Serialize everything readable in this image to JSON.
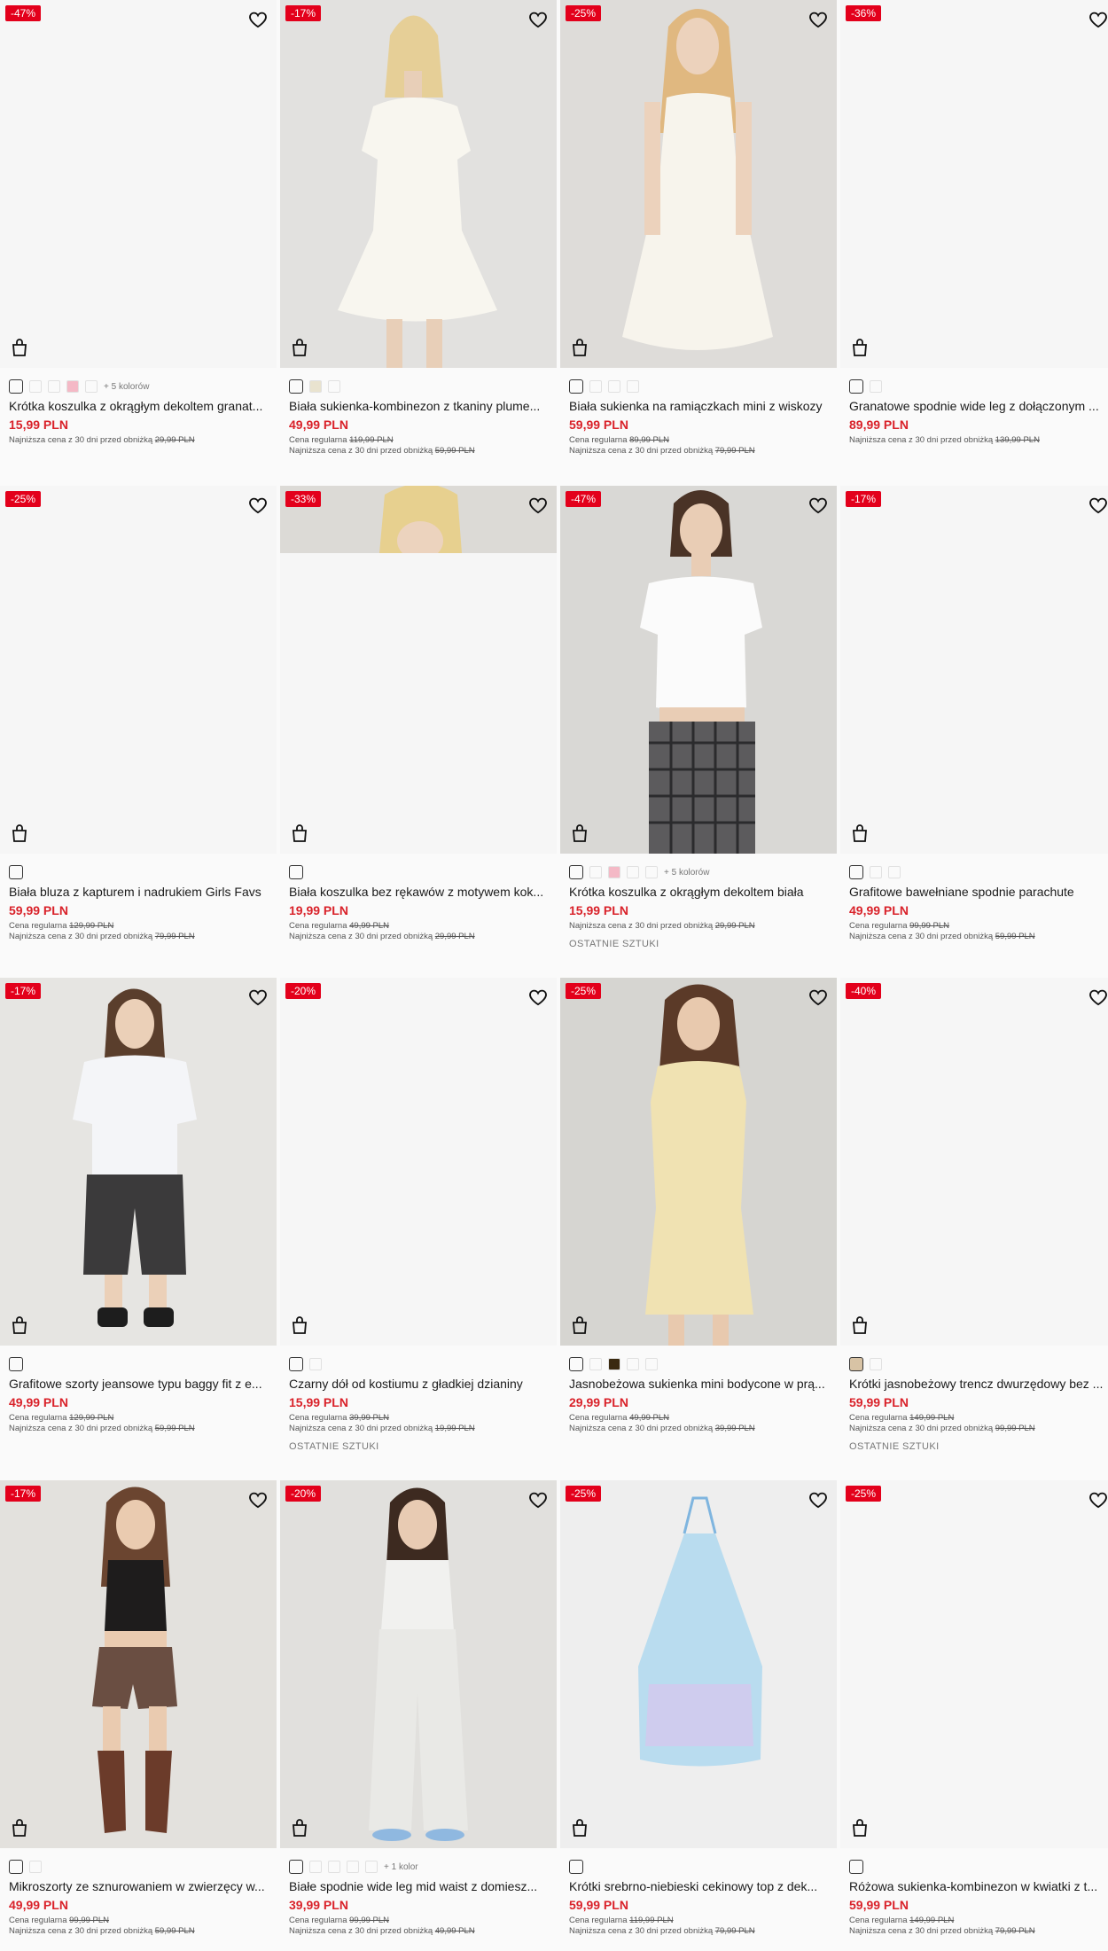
{
  "products": [
    {
      "discount": "-47%",
      "name": "Krótka koszulka z okrągłym dekoltem granat...",
      "price": "15,99 PLN",
      "regular_label": "",
      "regular_price": "",
      "lowest_label": "Najniższa cena z 30 dni przed obniżką",
      "lowest_price": "29,99 PLN",
      "more_colors": "+ 5 kolorów",
      "last_items": ""
    },
    {
      "discount": "-17%",
      "name": "Biała sukienka-kombinezon z tkaniny plume...",
      "price": "49,99 PLN",
      "regular_label": "Cena regularna",
      "regular_price": "119,99 PLN",
      "lowest_label": "Najniższa cena z 30 dni przed obniżką",
      "lowest_price": "59,99 PLN",
      "more_colors": "",
      "last_items": ""
    },
    {
      "discount": "-25%",
      "name": "Biała sukienka na ramiączkach mini z wiskozy",
      "price": "59,99 PLN",
      "regular_label": "Cena regularna",
      "regular_price": "89,99 PLN",
      "lowest_label": "Najniższa cena z 30 dni przed obniżką",
      "lowest_price": "79,99 PLN",
      "more_colors": "",
      "last_items": ""
    },
    {
      "discount": "-36%",
      "name": "Granatowe spodnie wide leg z dołączonym ...",
      "price": "89,99 PLN",
      "regular_label": "",
      "regular_price": "",
      "lowest_label": "Najniższa cena z 30 dni przed obniżką",
      "lowest_price": "139,99 PLN",
      "more_colors": "",
      "last_items": ""
    },
    {
      "discount": "-25%",
      "name": "Biała bluza z kapturem i nadrukiem Girls Favs",
      "price": "59,99 PLN",
      "regular_label": "Cena regularna",
      "regular_price": "129,99 PLN",
      "lowest_label": "Najniższa cena z 30 dni przed obniżką",
      "lowest_price": "79,99 PLN",
      "more_colors": "",
      "last_items": ""
    },
    {
      "discount": "-33%",
      "name": "Biała koszulka bez rękawów z motywem kok...",
      "price": "19,99 PLN",
      "regular_label": "Cena regularna",
      "regular_price": "49,99 PLN",
      "lowest_label": "Najniższa cena z 30 dni przed obniżką",
      "lowest_price": "29,99 PLN",
      "more_colors": "",
      "last_items": ""
    },
    {
      "discount": "-47%",
      "name": "Krótka koszulka z okrągłym dekoltem biała",
      "price": "15,99 PLN",
      "regular_label": "",
      "regular_price": "",
      "lowest_label": "Najniższa cena z 30 dni przed obniżką",
      "lowest_price": "29,99 PLN",
      "more_colors": "+ 5 kolorów",
      "last_items": "OSTATNIE SZTUKI"
    },
    {
      "discount": "-17%",
      "name": "Grafitowe bawełniane spodnie parachute",
      "price": "49,99 PLN",
      "regular_label": "Cena regularna",
      "regular_price": "99,99 PLN",
      "lowest_label": "Najniższa cena z 30 dni przed obniżką",
      "lowest_price": "59,99 PLN",
      "more_colors": "",
      "last_items": ""
    },
    {
      "discount": "-17%",
      "name": "Grafitowe szorty jeansowe typu baggy fit z e...",
      "price": "49,99 PLN",
      "regular_label": "Cena regularna",
      "regular_price": "129,99 PLN",
      "lowest_label": "Najniższa cena z 30 dni przed obniżką",
      "lowest_price": "59,99 PLN",
      "more_colors": "",
      "last_items": ""
    },
    {
      "discount": "-20%",
      "name": "Czarny dół od kostiumu z gładkiej dzianiny",
      "price": "15,99 PLN",
      "regular_label": "Cena regularna",
      "regular_price": "39,99 PLN",
      "lowest_label": "Najniższa cena z 30 dni przed obniżką",
      "lowest_price": "19,99 PLN",
      "more_colors": "",
      "last_items": "OSTATNIE SZTUKI"
    },
    {
      "discount": "-25%",
      "name": "Jasnobeżowa sukienka mini bodycone w prą...",
      "price": "29,99 PLN",
      "regular_label": "Cena regularna",
      "regular_price": "49,99 PLN",
      "lowest_label": "Najniższa cena z 30 dni przed obniżką",
      "lowest_price": "39,99 PLN",
      "more_colors": "",
      "last_items": ""
    },
    {
      "discount": "-40%",
      "name": "Krótki jasnobeżowy trencz dwurzędowy bez ...",
      "price": "59,99 PLN",
      "regular_label": "Cena regularna",
      "regular_price": "149,99 PLN",
      "lowest_label": "Najniższa cena z 30 dni przed obniżką",
      "lowest_price": "99,99 PLN",
      "more_colors": "",
      "last_items": "OSTATNIE SZTUKI"
    },
    {
      "discount": "-17%",
      "name": "Mikroszorty ze sznurowaniem w zwierzęcy w...",
      "price": "49,99 PLN",
      "regular_label": "Cena regularna",
      "regular_price": "99,99 PLN",
      "lowest_label": "Najniższa cena z 30 dni przed obniżką",
      "lowest_price": "59,99 PLN",
      "more_colors": "",
      "last_items": ""
    },
    {
      "discount": "-20%",
      "name": "Białe spodnie wide leg mid waist z domiesz...",
      "price": "39,99 PLN",
      "regular_label": "Cena regularna",
      "regular_price": "99,99 PLN",
      "lowest_label": "Najniższa cena z 30 dni przed obniżką",
      "lowest_price": "49,99 PLN",
      "more_colors": "+ 1 kolor",
      "last_items": ""
    },
    {
      "discount": "-25%",
      "name": "Krótki srebrno-niebieski cekinowy top z dek...",
      "price": "59,99 PLN",
      "regular_label": "Cena regularna",
      "regular_price": "119,99 PLN",
      "lowest_label": "Najniższa cena z 30 dni przed obniżką",
      "lowest_price": "79,99 PLN",
      "more_colors": "",
      "last_items": ""
    },
    {
      "discount": "-25%",
      "name": "Różowa sukienka-kombinezon w kwiatki z t...",
      "price": "59,99 PLN",
      "regular_label": "Cena regularna",
      "regular_price": "149,99 PLN",
      "lowest_label": "Najniższa cena z 30 dni przed obniżką",
      "lowest_price": "79,99 PLN",
      "more_colors": "",
      "last_items": ""
    }
  ],
  "colors": {
    "badge": "#e3001b",
    "price": "#d9222a"
  },
  "icons": {
    "wishlist": "heart-icon",
    "cart": "shopping-bag-icon"
  }
}
